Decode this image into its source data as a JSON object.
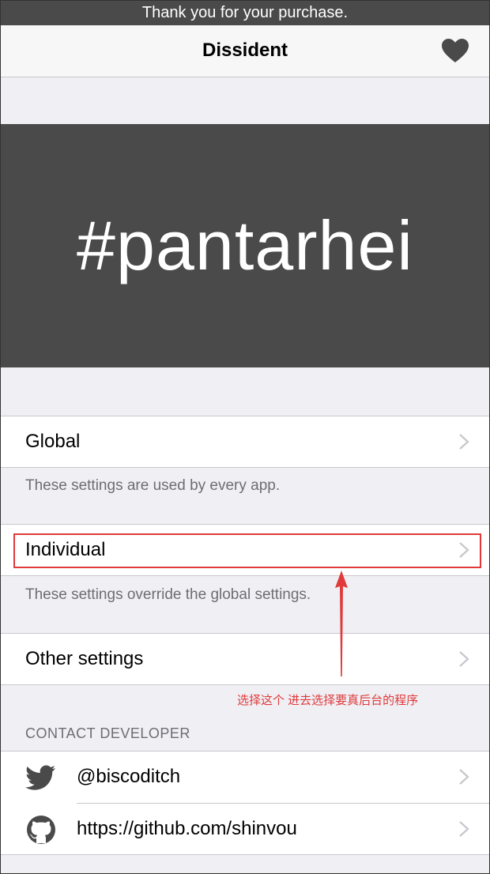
{
  "purchase_banner": {
    "text": "Thank you for your purchase."
  },
  "nav": {
    "title": "Dissident",
    "heart_icon": "heart-icon"
  },
  "hero": {
    "text": "#pantarhei"
  },
  "sections": {
    "global": {
      "label": "Global",
      "footer": "These settings are used by every app."
    },
    "individual": {
      "label": "Individual",
      "footer": "These settings override the global settings."
    },
    "other": {
      "label": "Other settings"
    }
  },
  "contact": {
    "header": "CONTACT DEVELOPER",
    "items": [
      {
        "icon": "twitter-icon",
        "label": "@biscoditch"
      },
      {
        "icon": "github-icon",
        "label": "https://github.com/shinvou"
      }
    ]
  },
  "annotation": {
    "text": "选择这个 进去选择要真后台的程序",
    "color": "#e03a3a"
  },
  "colors": {
    "banner_bg": "#4a4a4a",
    "background": "#efeff4",
    "chevron": "#c7c7cc"
  }
}
